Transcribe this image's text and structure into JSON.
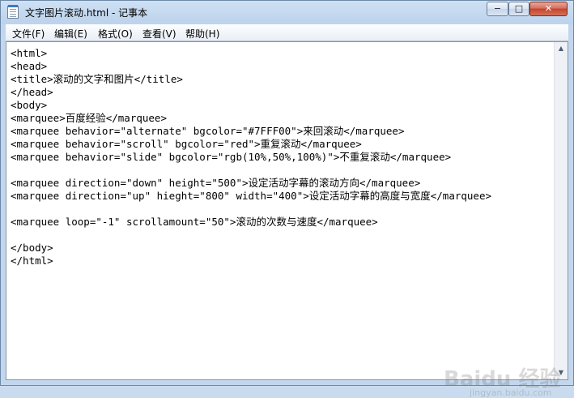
{
  "window": {
    "title": "文字图片滚动.html - 记事本"
  },
  "controls": {
    "minimize": "−",
    "maximize": "□",
    "close": "✕"
  },
  "menu": [
    {
      "label": "文件(F)"
    },
    {
      "label": "编辑(E)"
    },
    {
      "label": "格式(O)"
    },
    {
      "label": "查看(V)"
    },
    {
      "label": "帮助(H)"
    }
  ],
  "editor": {
    "lines": [
      "<html>",
      "<head>",
      "<title>滚动的文字和图片</title>",
      "</head>",
      "<body>",
      "<marquee>百度经验</marquee>",
      "<marquee behavior=\"alternate\" bgcolor=\"#7FFF00\">来回滚动</marquee>",
      "<marquee behavior=\"scroll\" bgcolor=\"red\">重复滚动</marquee>",
      "<marquee behavior=\"slide\" bgcolor=\"rgb(10%,50%,100%)\">不重复滚动</marquee>",
      "",
      "<marquee direction=\"down\" height=\"500\">设定活动字幕的滚动方向</marquee>",
      "<marquee direction=\"up\" hieght=\"800\" width=\"400\">设定活动字幕的高度与宽度</marquee>",
      "",
      "<marquee loop=\"-1\" scrollamount=\"50\">滚动的次数与速度</marquee>",
      "",
      "</body>",
      "</html>"
    ]
  },
  "scrollbar": {
    "up_icon": "▲",
    "down_icon": "▼"
  },
  "watermark": {
    "text": "Baidu 经验",
    "sub": "jingyan.baidu.com"
  }
}
